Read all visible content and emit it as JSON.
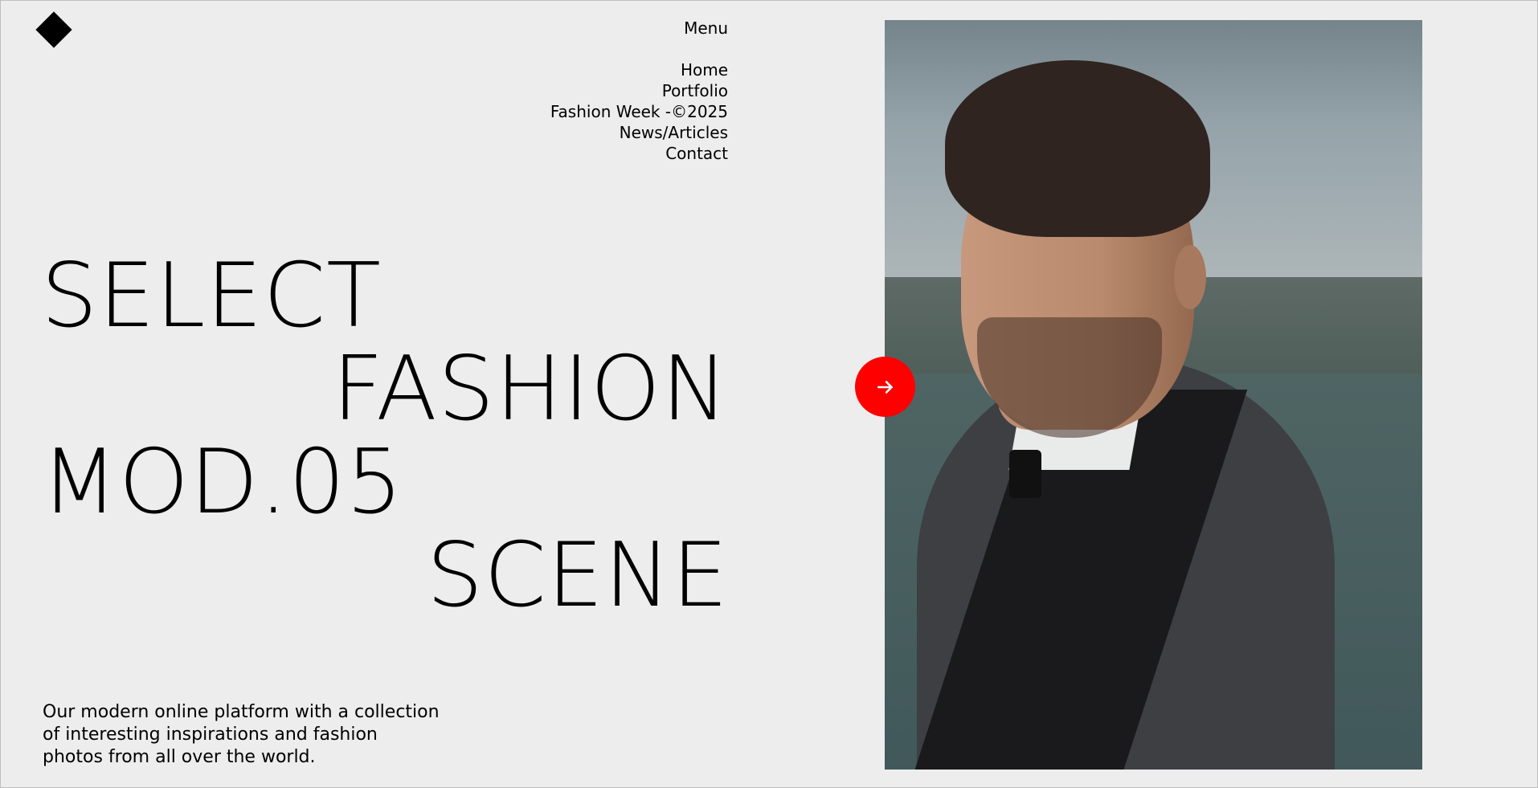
{
  "header": {
    "logo_icon": "diamond-logo-icon",
    "menu_label": "Menu"
  },
  "nav": {
    "items": [
      {
        "label": "Home"
      },
      {
        "label": "Portfolio"
      },
      {
        "label": "Fashion Week -©2025"
      },
      {
        "label": "News/Articles"
      },
      {
        "label": "Contact"
      }
    ]
  },
  "hero": {
    "lines": [
      "SELECT",
      "FASHION",
      "MOD.05",
      "SCENE"
    ],
    "tagline_lines": [
      "Our modern online platform with a collection",
      "of interesting inspirations and fashion",
      "photos from all over the world."
    ]
  },
  "media": {
    "next_button_icon": "arrow-right-icon",
    "accent_color": "#ff0000"
  }
}
